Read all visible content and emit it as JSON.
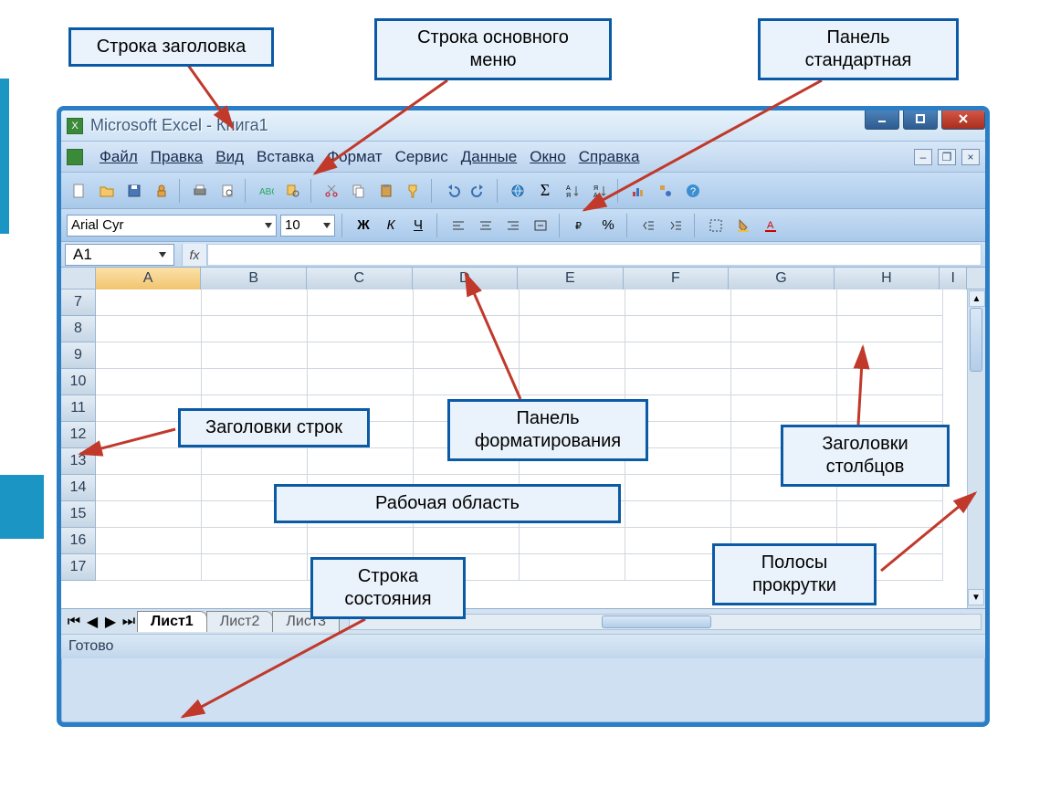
{
  "callouts": {
    "title_row": "Строка заголовка",
    "main_menu_row": "Строка основного\nменю",
    "standard_panel": "Панель\nстандартная",
    "row_headers": "Заголовки строк",
    "format_panel": "Панель\nформатирования",
    "col_headers": "Заголовки\nстолбцов",
    "work_area": "Рабочая область",
    "status_row": "Строка\nсостояния",
    "scrollbars": "Полосы\nпрокрутки"
  },
  "window": {
    "title": "Microsoft Excel - Книга1",
    "min": "_",
    "max": "▢",
    "close": "✕"
  },
  "menu": {
    "file": "Файл",
    "edit": "Правка",
    "view": "Вид",
    "insert": "Вставка",
    "format": "Формат",
    "service": "Сервис",
    "data": "Данные",
    "window_m": "Окно",
    "help": "Справка"
  },
  "format_bar": {
    "font": "Arial Cyr",
    "size": "10",
    "bold": "Ж",
    "italic": "К",
    "underline": "Ч",
    "currency": "%"
  },
  "name_fx": {
    "cell_ref": "A1",
    "fx": "fx"
  },
  "columns": [
    "A",
    "B",
    "C",
    "D",
    "E",
    "F",
    "G",
    "H",
    "I"
  ],
  "rows": [
    "7",
    "8",
    "9",
    "10",
    "11",
    "12",
    "13",
    "14",
    "15",
    "16",
    "17"
  ],
  "sheets": {
    "s1": "Лист1",
    "s2": "Лист2",
    "s3": "Лист3"
  },
  "status": "Готово"
}
